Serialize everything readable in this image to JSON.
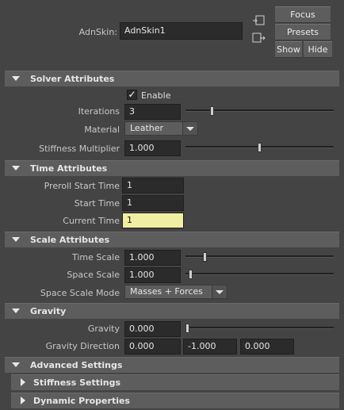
{
  "header": {
    "node_label": "AdnSkin:",
    "node_name": "AdnSkin1",
    "focus_label": "Focus",
    "presets_label": "Presets",
    "show_label": "Show",
    "hide_label": "Hide"
  },
  "sections": {
    "solver": "Solver Attributes",
    "time": "Time Attributes",
    "scale": "Scale Attributes",
    "gravity": "Gravity",
    "advanced": "Advanced Settings",
    "stiffness": "Stiffness Settings",
    "dynamic": "Dynamic Properties"
  },
  "solver": {
    "enable_label": "Enable",
    "enable_checked": true,
    "iterations_label": "Iterations",
    "iterations_value": "3",
    "iterations_slider": 0.17,
    "material_label": "Material",
    "material_value": "Leather",
    "stiffness_label": "Stiffness Multiplier",
    "stiffness_value": "1.000",
    "stiffness_slider": 0.5
  },
  "time": {
    "preroll_label": "Preroll Start Time",
    "preroll_value": "1",
    "start_label": "Start Time",
    "start_value": "1",
    "current_label": "Current Time",
    "current_value": "1"
  },
  "scale": {
    "time_scale_label": "Time Scale",
    "time_scale_value": "1.000",
    "time_scale_slider": 0.12,
    "space_scale_label": "Space Scale",
    "space_scale_value": "1.000",
    "space_scale_slider": 0.02,
    "mode_label": "Space Scale Mode",
    "mode_value": "Masses + Forces"
  },
  "gravity": {
    "gravity_label": "Gravity",
    "gravity_value": "0.000",
    "gravity_slider": 0.0,
    "direction_label": "Gravity Direction",
    "direction_x": "0.000",
    "direction_y": "-1.000",
    "direction_z": "0.000"
  },
  "colors": {
    "background": "#444444",
    "section_header": "#5d5d5d",
    "field": "#2b2b2b",
    "highlight_field": "#f0eea2"
  }
}
